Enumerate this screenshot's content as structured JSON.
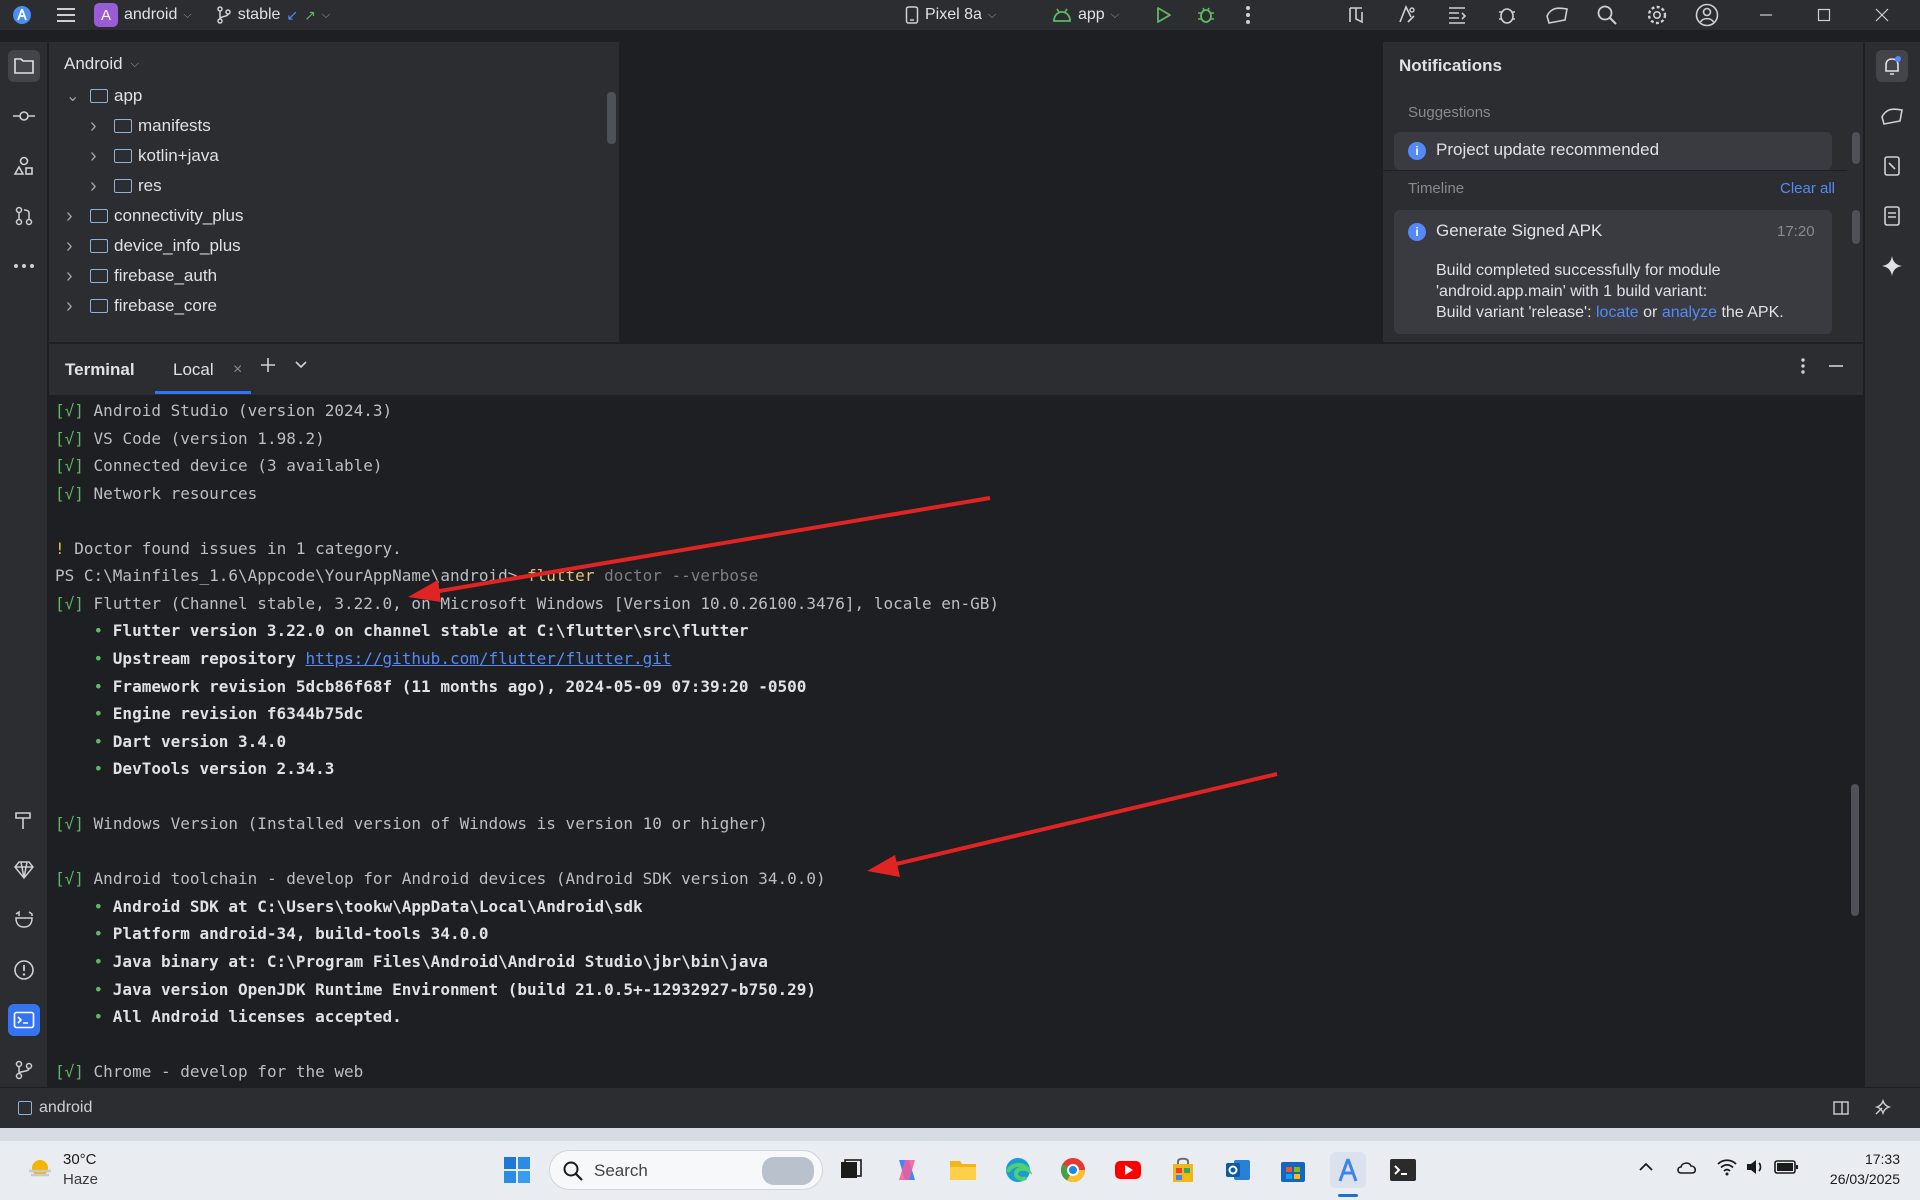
{
  "titlebar": {
    "project_badge": "A",
    "project_name": "android",
    "branch": "stable",
    "device": "Pixel 8a",
    "run_config": "app"
  },
  "project_panel": {
    "view_selector": "Android",
    "items": [
      {
        "label": "app",
        "level": 0,
        "expanded": true
      },
      {
        "label": "manifests",
        "level": 1,
        "expanded": false
      },
      {
        "label": "kotlin+java",
        "level": 1,
        "expanded": false
      },
      {
        "label": "res",
        "level": 1,
        "expanded": false
      },
      {
        "label": "connectivity_plus",
        "level": 0,
        "expanded": false
      },
      {
        "label": "device_info_plus",
        "level": 0,
        "expanded": false
      },
      {
        "label": "firebase_auth",
        "level": 0,
        "expanded": false
      },
      {
        "label": "firebase_core",
        "level": 0,
        "expanded": false
      }
    ]
  },
  "notifications": {
    "title": "Notifications",
    "suggestions_label": "Suggestions",
    "suggestion_title": "Project update recommended",
    "timeline_label": "Timeline",
    "clear_all": "Clear all",
    "event_title": "Generate Signed APK",
    "event_time": "17:20",
    "event_line1": "Build completed successfully for module",
    "event_line2": "'android.app.main' with 1 build variant:",
    "event_line3_prefix": "Build variant 'release':",
    "event_locate": "locate",
    "event_or": "or",
    "event_analyze": "analyze",
    "event_suffix": "the APK."
  },
  "terminal_tabs": {
    "title": "Terminal",
    "tab": "Local"
  },
  "terminal": {
    "lines": [
      {
        "type": "check",
        "mark": "[√]",
        "text": "Android Studio (version 2024.3)"
      },
      {
        "type": "check",
        "mark": "[√]",
        "text": "VS Code (version 1.98.2)"
      },
      {
        "type": "check",
        "mark": "[√]",
        "text": "Connected device (3 available)"
      },
      {
        "type": "check",
        "mark": "[√]",
        "text": "Network resources"
      },
      {
        "type": "blank"
      },
      {
        "type": "warn",
        "mark": "!",
        "text": "Doctor found issues in 1 category."
      },
      {
        "type": "prompt",
        "prompt": "PS C:\\Mainfiles_1.6\\Appcode\\YourAppName\\android> ",
        "cmd": "flutter",
        "args": " doctor --verbose"
      },
      {
        "type": "check",
        "mark": "[√]",
        "text": "Flutter (Channel stable, 3.22.0, on Microsoft Windows [Version 10.0.26100.3476], locale en-GB)"
      },
      {
        "type": "bullet",
        "text": "Flutter version 3.22.0 on channel stable at C:\\flutter\\src\\flutter"
      },
      {
        "type": "bullet_link",
        "text": "Upstream repository ",
        "link": "https://github.com/flutter/flutter.git"
      },
      {
        "type": "bullet",
        "text": "Framework revision 5dcb86f68f (11 months ago), 2024-05-09 07:39:20 -0500"
      },
      {
        "type": "bullet",
        "text": "Engine revision f6344b75dc"
      },
      {
        "type": "bullet",
        "text": "Dart version 3.4.0"
      },
      {
        "type": "bullet",
        "text": "DevTools version 2.34.3"
      },
      {
        "type": "blank"
      },
      {
        "type": "check",
        "mark": "[√]",
        "text": "Windows Version (Installed version of Windows is version 10 or higher)"
      },
      {
        "type": "blank"
      },
      {
        "type": "check",
        "mark": "[√]",
        "text": "Android toolchain - develop for Android devices (Android SDK version 34.0.0)"
      },
      {
        "type": "bullet",
        "text": "Android SDK at C:\\Users\\tookw\\AppData\\Local\\Android\\sdk"
      },
      {
        "type": "bullet",
        "text": "Platform android-34, build-tools 34.0.0"
      },
      {
        "type": "bullet",
        "text": "Java binary at: C:\\Program Files\\Android\\Android Studio\\jbr\\bin\\java"
      },
      {
        "type": "bullet",
        "text": "Java version OpenJDK Runtime Environment (build 21.0.5+-12932927-b750.29)"
      },
      {
        "type": "bullet",
        "text": "All Android licenses accepted."
      },
      {
        "type": "blank"
      },
      {
        "type": "check",
        "mark": "[√]",
        "text": "Chrome - develop for the web"
      }
    ]
  },
  "statusbar": {
    "project": "android"
  },
  "taskbar": {
    "weather_temp": "30°C",
    "weather_desc": "Haze",
    "search_placeholder": "Search",
    "time": "17:33",
    "date": "26/03/2025"
  },
  "colors": {
    "accent": "#548af7",
    "ok_green": "#5fb865",
    "arrow_red": "#e02424"
  }
}
